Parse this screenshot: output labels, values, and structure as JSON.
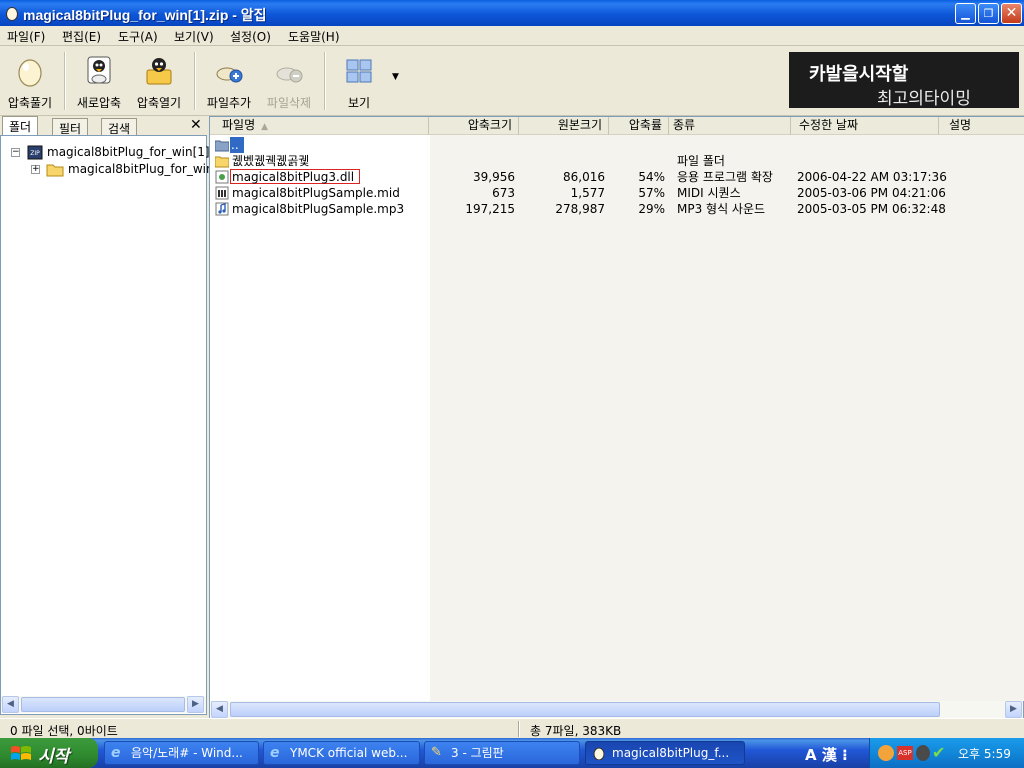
{
  "window": {
    "title": "magical8bitPlug_for_win[1].zip - 알집"
  },
  "menu": [
    "파일(F)",
    "편집(E)",
    "도구(A)",
    "보기(V)",
    "설정(O)",
    "도움말(H)"
  ],
  "toolbar": {
    "extract": "압축풀기",
    "new_archive": "새로압축",
    "open_archive": "압축열기",
    "add_file": "파일추가",
    "delete_file": "파일삭제",
    "view": "보기"
  },
  "banner": {
    "line1": "카발을시작할",
    "line2": "최고의타이밍"
  },
  "left_tabs": [
    "폴더",
    "필터",
    "검색"
  ],
  "tree": {
    "root": "magical8bitPlug_for_win[1].",
    "child": "magical8bitPlug_for_win"
  },
  "columns": [
    "파일명",
    "압축크기",
    "원본크기",
    "압축률",
    "종류",
    "수정한 날짜",
    "설명"
  ],
  "files": [
    {
      "name": "..",
      "packed": "",
      "size": "",
      "ratio": "",
      "type": "",
      "date": ""
    },
    {
      "name": "궶벴궶궥궶곩궻",
      "packed": "",
      "size": "",
      "ratio": "",
      "type": "파일 폴더",
      "date": ""
    },
    {
      "name": "magical8bitPlug3.dll",
      "packed": "39,956",
      "size": "86,016",
      "ratio": "54%",
      "type": "응용 프로그램 확장",
      "date": "2006-04-22 AM 03:17:36"
    },
    {
      "name": "magical8bitPlugSample.mid",
      "packed": "673",
      "size": "1,577",
      "ratio": "57%",
      "type": "MIDI 시퀀스",
      "date": "2005-03-06 PM 04:21:06"
    },
    {
      "name": "magical8bitPlugSample.mp3",
      "packed": "197,215",
      "size": "278,987",
      "ratio": "29%",
      "type": "MP3 형식 사운드",
      "date": "2005-03-05 PM 06:32:48"
    }
  ],
  "status": {
    "left": "0 파일 선택,  0바이트",
    "right": "총 7파일,  383KB"
  },
  "taskbar": {
    "start": "시작",
    "tasks": [
      "음악/노래# - Wind...",
      "YMCK official web...",
      "3 - 그림판",
      "magical8bitPlug_f..."
    ],
    "lang": "A 漢 ⁝",
    "clock": "오후 5:59"
  },
  "colors": {
    "titlebar": "#0a5fe0",
    "taskbar": "#2157d7",
    "start": "#2f8a2f",
    "selection": "#316ac5",
    "highlight_box": "#dd2222"
  }
}
